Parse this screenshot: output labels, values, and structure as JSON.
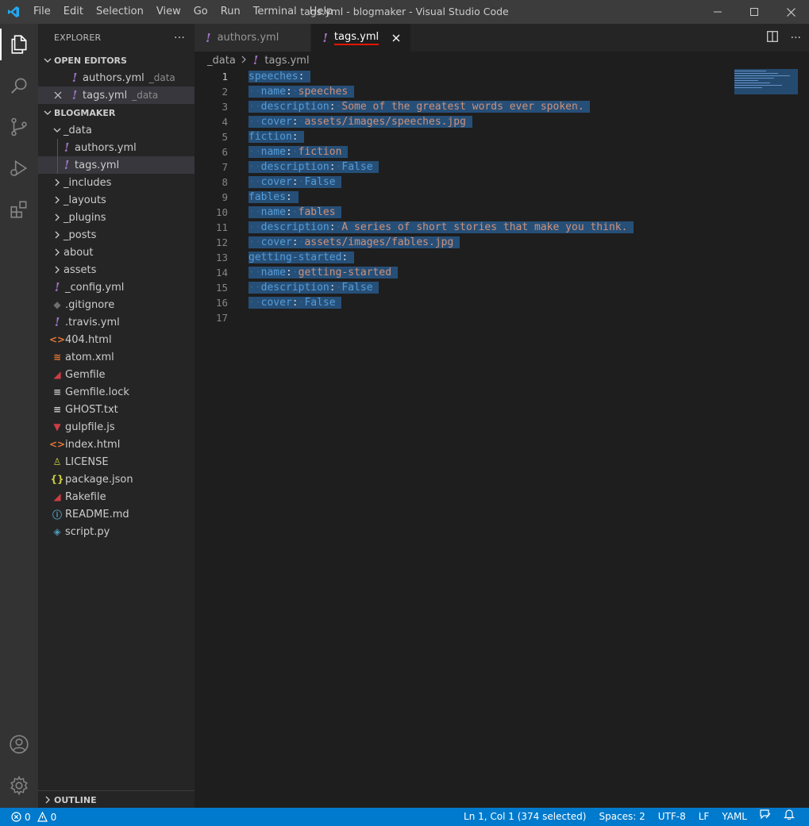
{
  "window": {
    "title": "tags.yml - blogmaker - Visual Studio Code",
    "menu": [
      "File",
      "Edit",
      "Selection",
      "View",
      "Go",
      "Run",
      "Terminal",
      "Help"
    ]
  },
  "sidebar": {
    "title": "EXPLORER",
    "more": "···",
    "open_editors": {
      "label": "OPEN EDITORS",
      "items": [
        {
          "name": "authors.yml",
          "desc": "_data"
        },
        {
          "name": "tags.yml",
          "desc": "_data"
        }
      ]
    },
    "workspace": {
      "label": "BLOGMAKER",
      "data_folder": "_data",
      "data_files": [
        "authors.yml",
        "tags.yml"
      ],
      "folders": [
        "_includes",
        "_layouts",
        "_plugins",
        "_posts",
        "about",
        "assets"
      ],
      "files": [
        {
          "name": "_config.yml",
          "icon": "yaml-icon",
          "color": "#a074c4",
          "glyph": "!"
        },
        {
          "name": ".gitignore",
          "icon": "git-icon",
          "color": "#6d6d6d",
          "glyph": "◆"
        },
        {
          "name": ".travis.yml",
          "icon": "yaml-icon",
          "color": "#a074c4",
          "glyph": "!"
        },
        {
          "name": "404.html",
          "icon": "html-icon",
          "color": "#e37933",
          "glyph": "<>"
        },
        {
          "name": "atom.xml",
          "icon": "rss-icon",
          "color": "#e37933",
          "glyph": "≋"
        },
        {
          "name": "Gemfile",
          "icon": "ruby-icon",
          "color": "#cc3e44",
          "glyph": "◢"
        },
        {
          "name": "Gemfile.lock",
          "icon": "text-icon",
          "color": "#cccccc",
          "glyph": "≡"
        },
        {
          "name": "GHOST.txt",
          "icon": "text-icon",
          "color": "#cccccc",
          "glyph": "≡"
        },
        {
          "name": "gulpfile.js",
          "icon": "gulp-icon",
          "color": "#cc3e44",
          "glyph": "▼"
        },
        {
          "name": "index.html",
          "icon": "html-icon",
          "color": "#e37933",
          "glyph": "<>"
        },
        {
          "name": "LICENSE",
          "icon": "license-icon",
          "color": "#cbcb41",
          "glyph": "♙"
        },
        {
          "name": "package.json",
          "icon": "json-icon",
          "color": "#cbcb41",
          "glyph": "{}"
        },
        {
          "name": "Rakefile",
          "icon": "ruby-icon",
          "color": "#cc3e44",
          "glyph": "◢"
        },
        {
          "name": "README.md",
          "icon": "info-icon",
          "color": "#519aba",
          "glyph": "ⓘ"
        },
        {
          "name": "script.py",
          "icon": "python-icon",
          "color": "#519aba",
          "glyph": "◈"
        }
      ]
    },
    "outline": "OUTLINE"
  },
  "tabs": [
    {
      "label": "authors.yml",
      "active": false
    },
    {
      "label": "tags.yml",
      "active": true
    }
  ],
  "breadcrumbs": [
    "_data",
    "tags.yml"
  ],
  "editor": {
    "line_numbers": [
      "1",
      "2",
      "3",
      "4",
      "5",
      "6",
      "7",
      "8",
      "9",
      "10",
      "11",
      "12",
      "13",
      "14",
      "15",
      "16",
      "17"
    ],
    "lines": [
      {
        "indent": "",
        "key": "speeches",
        "value": ""
      },
      {
        "indent": "··",
        "key": "name",
        "value": "speeches"
      },
      {
        "indent": "··",
        "key": "description",
        "value": "Some of the greatest words ever spoken."
      },
      {
        "indent": "··",
        "key": "cover",
        "value": "assets/images/speeches.jpg"
      },
      {
        "indent": "",
        "key": "fiction",
        "value": ""
      },
      {
        "indent": "··",
        "key": "name",
        "value": "fiction"
      },
      {
        "indent": "··",
        "key": "description",
        "value": "False"
      },
      {
        "indent": "··",
        "key": "cover",
        "value": "False"
      },
      {
        "indent": "",
        "key": "fables",
        "value": ""
      },
      {
        "indent": "··",
        "key": "name",
        "value": "fables"
      },
      {
        "indent": "··",
        "key": "description",
        "value": "A series of short stories that make you think."
      },
      {
        "indent": "··",
        "key": "cover",
        "value": "assets/images/fables.jpg"
      },
      {
        "indent": "",
        "key": "getting-started",
        "value": ""
      },
      {
        "indent": "··",
        "key": "name",
        "value": "getting-started"
      },
      {
        "indent": "··",
        "key": "description",
        "value": "False"
      },
      {
        "indent": "··",
        "key": "cover",
        "value": "False"
      },
      {
        "indent": "",
        "key": "",
        "value": ""
      }
    ]
  },
  "statusbar": {
    "errors": "0",
    "warnings": "0",
    "position": "Ln 1, Col 1 (374 selected)",
    "spaces": "Spaces: 2",
    "encoding": "UTF-8",
    "eol": "LF",
    "language": "YAML"
  },
  "colors": {
    "accent": "#007acc",
    "selection": "#264f78",
    "yaml_key": "#569cd6",
    "yaml_string": "#ce9178",
    "tab_underline": "#e51400"
  }
}
